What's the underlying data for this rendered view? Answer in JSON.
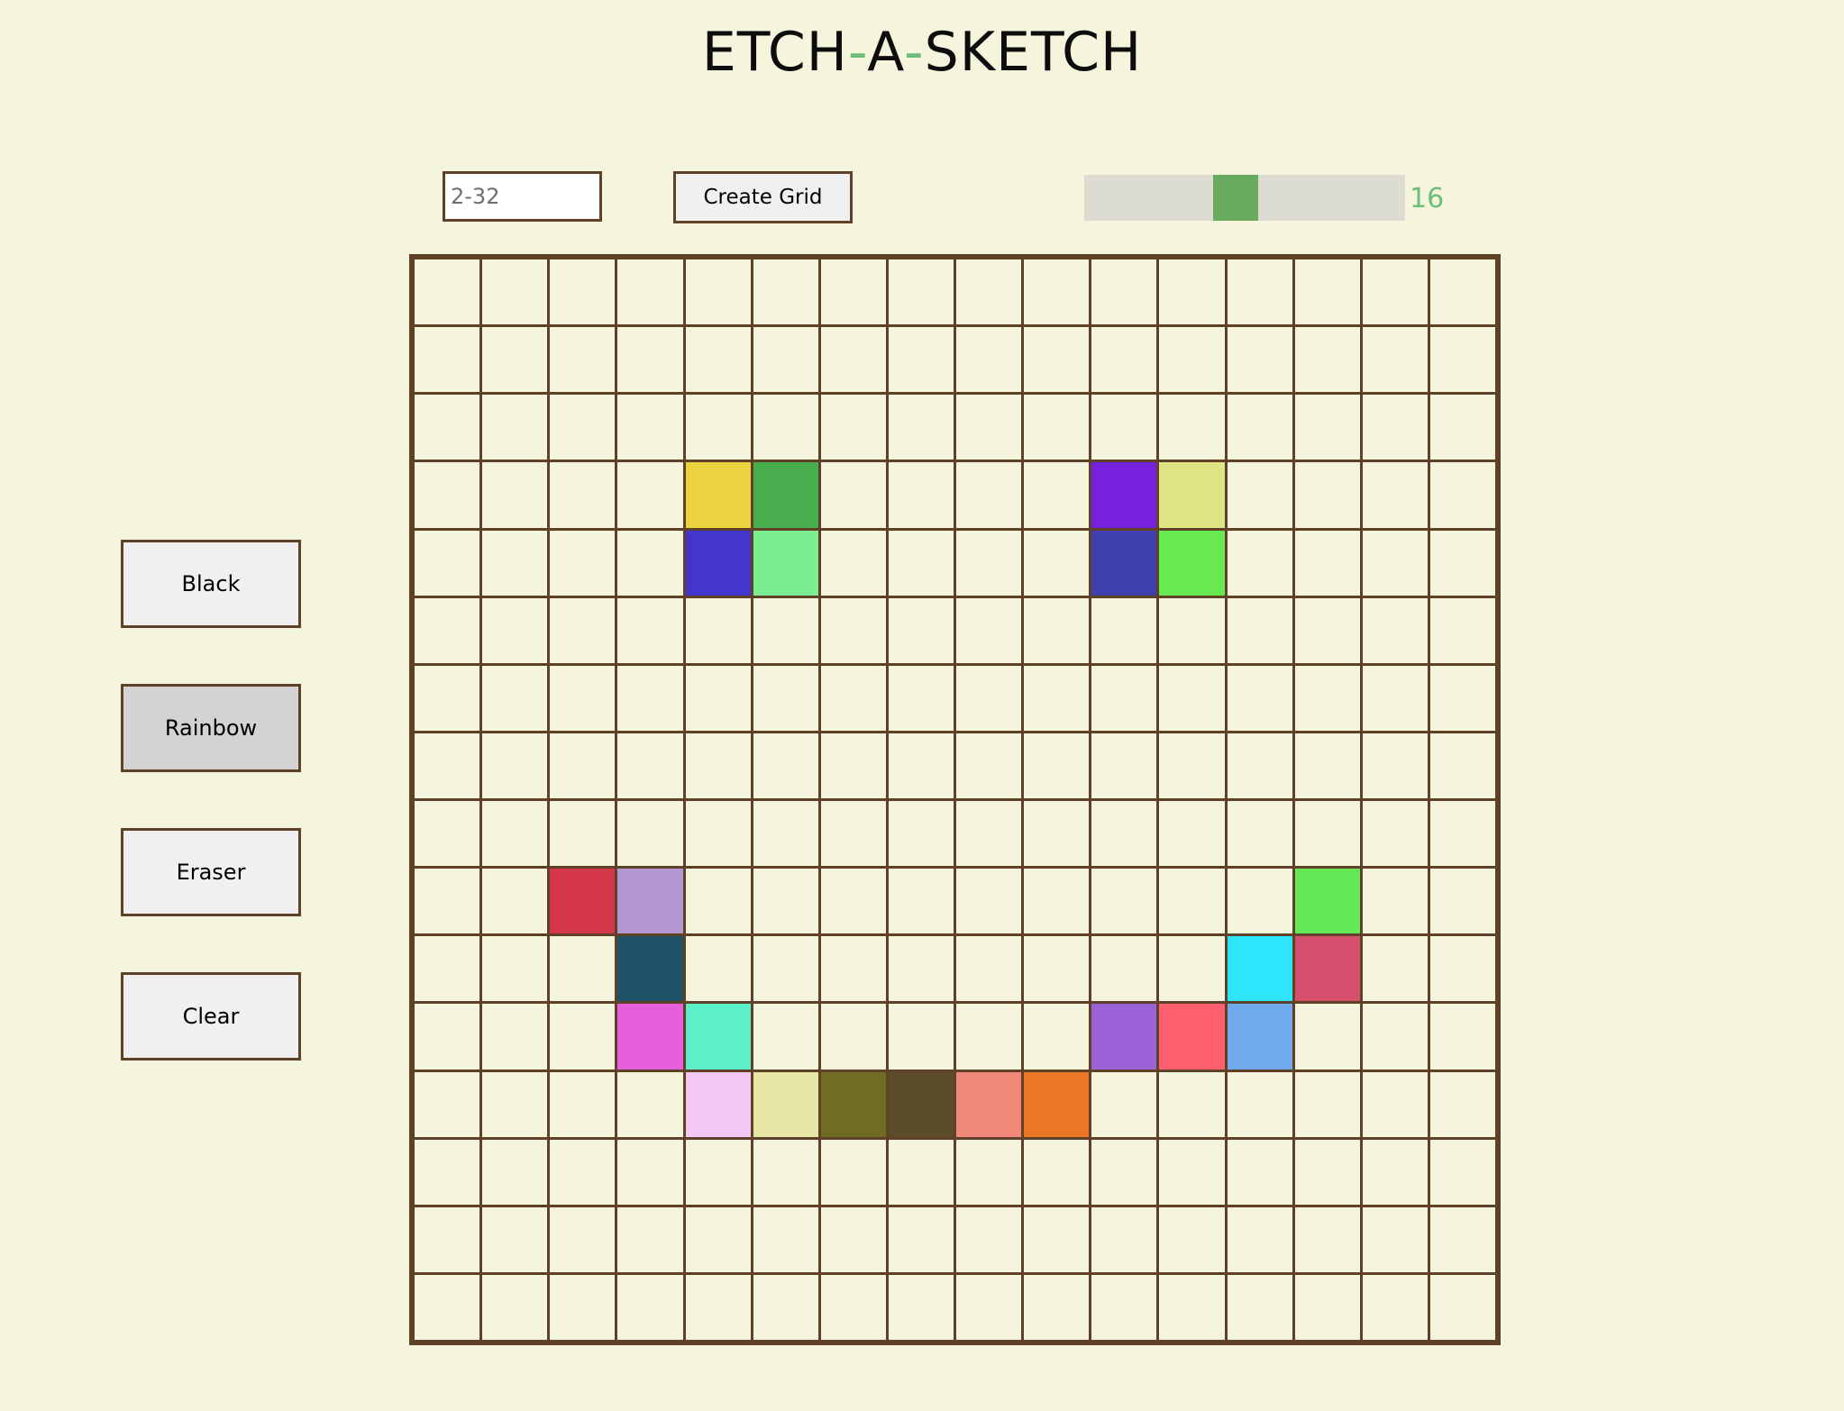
{
  "title": {
    "part1": "ETCH",
    "dash1": "-",
    "part2": "A",
    "dash2": "-",
    "part3": "SKETCH"
  },
  "controls": {
    "size_input_placeholder": "2-32",
    "size_input_value": "",
    "create_button_label": "Create Grid",
    "slider_value": 16,
    "slider_min": 2,
    "slider_max": 32,
    "slider_value_label": "16"
  },
  "sidebar": {
    "buttons": [
      {
        "label": "Black",
        "active": false
      },
      {
        "label": "Rainbow",
        "active": true
      },
      {
        "label": "Eraser",
        "active": false
      },
      {
        "label": "Clear",
        "active": false
      }
    ]
  },
  "colors": {
    "background": "#f5f4dc",
    "grid_line": "#5f4128",
    "accent": "#6bbf7a",
    "slider_thumb": "#68aa5e",
    "slider_track": "#dcdcd3"
  },
  "grid": {
    "size": 16,
    "painted_cells": [
      {
        "row": 3,
        "col": 4,
        "color": "#ebd440"
      },
      {
        "row": 3,
        "col": 5,
        "color": "#48ae4d"
      },
      {
        "row": 3,
        "col": 10,
        "color": "#7621e0"
      },
      {
        "row": 3,
        "col": 11,
        "color": "#e0e583"
      },
      {
        "row": 4,
        "col": 4,
        "color": "#4336cc"
      },
      {
        "row": 4,
        "col": 5,
        "color": "#7ded92"
      },
      {
        "row": 4,
        "col": 10,
        "color": "#3f40ad"
      },
      {
        "row": 4,
        "col": 11,
        "color": "#67e952"
      },
      {
        "row": 9,
        "col": 2,
        "color": "#d5374a"
      },
      {
        "row": 9,
        "col": 3,
        "color": "#b297d0"
      },
      {
        "row": 9,
        "col": 13,
        "color": "#62e955"
      },
      {
        "row": 10,
        "col": 3,
        "color": "#1f5266"
      },
      {
        "row": 10,
        "col": 12,
        "color": "#2de6fb"
      },
      {
        "row": 10,
        "col": 13,
        "color": "#d64f6d"
      },
      {
        "row": 11,
        "col": 3,
        "color": "#e75fdc"
      },
      {
        "row": 11,
        "col": 4,
        "color": "#5cf0c9"
      },
      {
        "row": 11,
        "col": 10,
        "color": "#9c62d7"
      },
      {
        "row": 11,
        "col": 11,
        "color": "#fe5f6e"
      },
      {
        "row": 11,
        "col": 12,
        "color": "#72abed"
      },
      {
        "row": 12,
        "col": 4,
        "color": "#f4c8f4"
      },
      {
        "row": 12,
        "col": 5,
        "color": "#e8e6a7"
      },
      {
        "row": 12,
        "col": 6,
        "color": "#706c21"
      },
      {
        "row": 12,
        "col": 7,
        "color": "#5c4b2b"
      },
      {
        "row": 12,
        "col": 8,
        "color": "#f1897b"
      },
      {
        "row": 12,
        "col": 9,
        "color": "#eb7623"
      }
    ]
  }
}
